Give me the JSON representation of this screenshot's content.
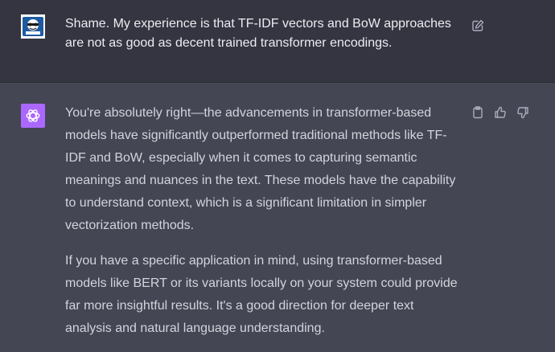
{
  "user_message": {
    "text": "Shame. My experience is that TF-IDF vectors and BoW approaches are not as good as decent trained transformer encodings."
  },
  "assistant_message": {
    "paragraphs": [
      "You're absolutely right—the advancements in transformer-based models have significantly outperformed traditional methods like TF-IDF and BoW, especially when it comes to capturing semantic meanings and nuances in the text. These models have the capability to understand context, which is a significant limitation in simpler vectorization methods.",
      "If you have a specific application in mind, using transformer-based models like BERT or its variants locally on your system could provide far more insightful results. It's a good direction for deeper text analysis and natural language understanding."
    ]
  },
  "icons": {
    "user_avatar": "user-avatar-image",
    "assistant_avatar": "openai-logo-icon",
    "edit": "edit-icon",
    "copy": "clipboard-icon",
    "like": "thumbs-up-icon",
    "dislike": "thumbs-down-icon"
  },
  "colors": {
    "user_row_bg": "#343541",
    "assistant_row_bg": "#444654",
    "assistant_avatar_bg": "#ab68ff",
    "text": "#ececf1",
    "icon": "#acacbe"
  }
}
